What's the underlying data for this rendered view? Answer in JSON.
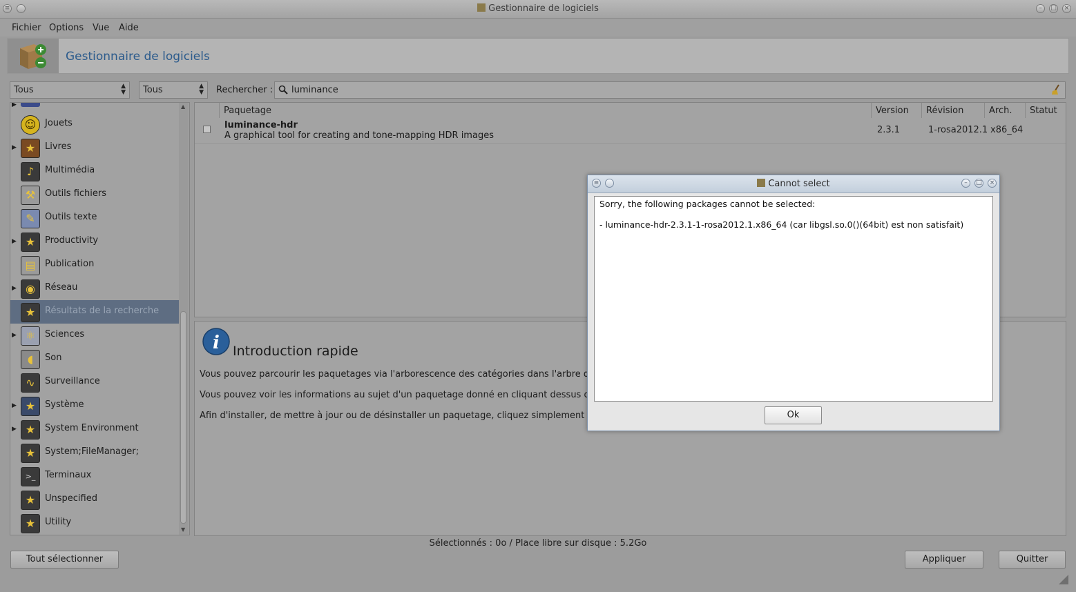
{
  "window": {
    "title": "Gestionnaire de logiciels"
  },
  "menubar": [
    "Fichier",
    "Options",
    "Vue",
    "Aide"
  ],
  "banner": {
    "title": "Gestionnaire de logiciels"
  },
  "filters": {
    "combo1": "Tous",
    "combo2": "Tous",
    "search_label": "Rechercher :",
    "search_value": "luminance"
  },
  "categories": [
    {
      "label": "Jouets",
      "icon": "smiley-icon",
      "expandable": false
    },
    {
      "label": "Livres",
      "icon": "book-icon",
      "expandable": true
    },
    {
      "label": "Multimédia",
      "icon": "multimedia-icon",
      "expandable": false
    },
    {
      "label": "Outils fichiers",
      "icon": "file-tools-icon",
      "expandable": false
    },
    {
      "label": "Outils texte",
      "icon": "text-tools-icon",
      "expandable": false
    },
    {
      "label": "Productivity",
      "icon": "star-monitor-icon",
      "expandable": true
    },
    {
      "label": "Publication",
      "icon": "publication-icon",
      "expandable": false
    },
    {
      "label": "Réseau",
      "icon": "network-icon",
      "expandable": true
    },
    {
      "label": "Résultats de la recherche",
      "icon": "star-monitor-icon",
      "expandable": false,
      "selected": true
    },
    {
      "label": "Sciences",
      "icon": "science-icon",
      "expandable": true
    },
    {
      "label": "Son",
      "icon": "speaker-icon",
      "expandable": false
    },
    {
      "label": "Surveillance",
      "icon": "monitor-icon",
      "expandable": false
    },
    {
      "label": "Système",
      "icon": "system-icon",
      "expandable": true
    },
    {
      "label": "System Environment",
      "icon": "star-monitor-icon",
      "expandable": true
    },
    {
      "label": "System;FileManager;",
      "icon": "star-monitor-icon",
      "expandable": false
    },
    {
      "label": "Terminaux",
      "icon": "terminal-icon",
      "expandable": false
    },
    {
      "label": "Unspecified",
      "icon": "star-monitor-icon",
      "expandable": false
    },
    {
      "label": "Utility",
      "icon": "star-monitor-icon",
      "expandable": false
    }
  ],
  "table": {
    "headers": {
      "package": "Paquetage",
      "version": "Version",
      "revision": "Révision",
      "arch": "Arch.",
      "status": "Statut"
    },
    "rows": [
      {
        "name": "luminance-hdr",
        "summary": "A graphical tool for creating and tone-mapping HDR images",
        "version": "2.3.1",
        "revision": "1-rosa2012.1",
        "arch": "x86_64",
        "status": ""
      }
    ]
  },
  "info": {
    "heading": "Introduction rapide",
    "para1": "Vous pouvez parcourir les paquetages via l'arborescence des catégories dans l'arbre de gauche.",
    "para2": "Vous pouvez voir les informations au sujet d'un paquetage donné en cliquant dessus dans la liste",
    "para3": "Afin d'installer, de mettre à jour ou de désinstaller un paquetage, cliquez simplement sur son icône"
  },
  "status": "Sélectionnés : 0o / Place libre sur disque : 5.2Go",
  "buttons": {
    "select_all": "Tout sélectionner",
    "apply": "Appliquer",
    "quit": "Quitter"
  },
  "dialog": {
    "title": "Cannot select",
    "line1": "Sorry, the following packages cannot be selected:",
    "line2": "- luminance-hdr-2.3.1-1-rosa2012.1.x86_64 (car libgsl.so.0()(64bit) est non satisfait)",
    "ok": "Ok"
  },
  "colors": {
    "banner_title": "#2c5b8c",
    "selection": "#5e6d82",
    "info_icon": "#2a5f9a"
  }
}
